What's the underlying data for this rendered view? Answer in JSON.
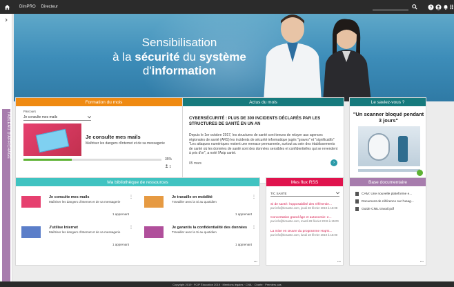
{
  "topbar": {
    "home_icon": "home-icon",
    "app_name": "DimPRO",
    "menu_director": "Directeur",
    "icons": [
      "search-icon",
      "help-icon",
      "user-icon",
      "bell-icon",
      "grid-icon"
    ]
  },
  "left_rail": {
    "tab_label": "TABLEAU D'AFFICHAGE"
  },
  "banner": {
    "line1": "Sensibilisation",
    "line2_pre": "à la ",
    "line2_b1": "sécurité",
    "line2_mid": " du ",
    "line2_b2": "système",
    "line3_pre": "d'",
    "line3_main": "information"
  },
  "formation": {
    "header": "Formation du mois",
    "parcours_label": "Parcours",
    "selected_parcours": "Je consulte mes mails",
    "title": "Je consulte mes mails",
    "description": "Maîtriser les dangers d'internet et de sa messagerie",
    "progress": 0.35,
    "progress_text": "35%",
    "participants": "1"
  },
  "actus": {
    "header": "Actus du mois",
    "title": "CYBERSÉCURITÉ : PLUS DE 300 INCIDENTS DÉCLARÉS PAR LES STRUCTURES DE SANTÉ EN UN AN",
    "text": "Depuis le 1er octobre 2017, les structures de santé sont tenues de relayer aux agences régionales de santé (ARS) les incidents de sécurité informatique jugés \"graves\" et \"significatifs\" \"Les attaques numériques restent une menace permanente, surtout au sein des établissements de santé où les données de santé sont des données sensibles et confidentielles qui se revendent à prix d'or\", a noté l'Asip santé.",
    "date": "05 mars"
  },
  "savez": {
    "header": "Le saviez-vous ?",
    "title": "\"Un scanner bloqué pendant 3 jours\""
  },
  "biblio": {
    "header": "Ma bibliothèque de ressources",
    "items": [
      {
        "title": "Je consulte mes mails",
        "desc": "Maîtriser les dangers d'internet et de sa messagerie",
        "count": "1 apprenant",
        "color": "#e6406f"
      },
      {
        "title": "Je travaille en mobilité",
        "desc": "Travailler avec la Si au quotidien",
        "count": "1 apprenant",
        "color": "#e69a42"
      },
      {
        "title": "J'utilise Internet",
        "desc": "Maîtriser les dangers d'internet et de sa messagerie",
        "count": "1 apprenant",
        "color": "#5b7ec9"
      },
      {
        "title": "Je garantis la confidentialité des données",
        "desc": "Travailler avec la Si au quotidien",
        "count": "1 apprenant",
        "color": "#b04f9b"
      }
    ]
  },
  "rss": {
    "header": "Mes flux RSS",
    "selected": "TIC SANTE",
    "items": [
      {
        "title": "Si de santé: l'opposabilité des référentie...",
        "meta": "par info@ticsante.com, jeudi 28 février 2019 à 15:08"
      },
      {
        "title": "Concertation grand âge et autonomie: e...",
        "meta": "par info@ticsante.com, mardi 26 février 2019 à 15:00"
      },
      {
        "title": "La mise en œuvre du programme Hop'E...",
        "meta": "par info@ticsante.com, lundi 18 février 2019 à 15:00"
      }
    ]
  },
  "basedoc": {
    "header": "Base documentaire",
    "docs": [
      "CAM: Une nouvelle plateforme e...",
      "Document de référence sur l'usag...",
      "Guide CNIL travail.pdf"
    ]
  },
  "footer": {
    "text": "Copyright 2019  ·  FCIP Éducation 2019  ·  Mentions légales  ·  CNIL  ·  Charte  ·  Premiers pas"
  }
}
